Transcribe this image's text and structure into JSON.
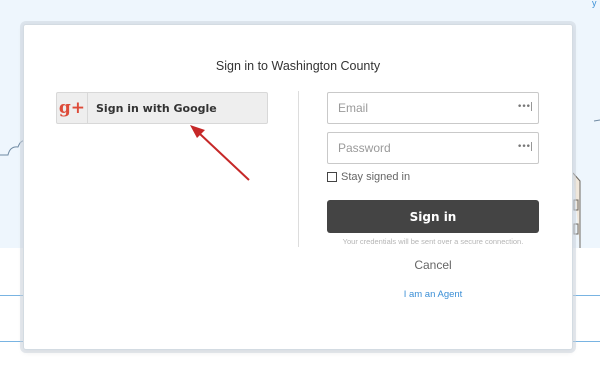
{
  "modal": {
    "title": "Sign in to Washington County"
  },
  "google": {
    "label": "Sign in with Google",
    "logo_text": "g+",
    "icon": "google-plus-icon",
    "logo_color": "#dd4b39"
  },
  "form": {
    "email_placeholder": "Email",
    "email_value": "",
    "password_placeholder": "Password",
    "password_value": "",
    "field_icon": "password-manager-key-icon",
    "field_icon_text": "•••|",
    "stay_signed_in_label": "Stay signed in",
    "stay_signed_in_checked": false,
    "signin_label": "Sign in",
    "secure_note": "Your credentials will be sent over a secure connection.",
    "cancel_label": "Cancel",
    "agent_link": "I am an Agent"
  },
  "annotation": {
    "icon": "red-arrow",
    "color": "#c62828"
  },
  "colors": {
    "signin_button": "#444444",
    "link": "#3b8fd6",
    "page_background": "#eef6fd"
  }
}
